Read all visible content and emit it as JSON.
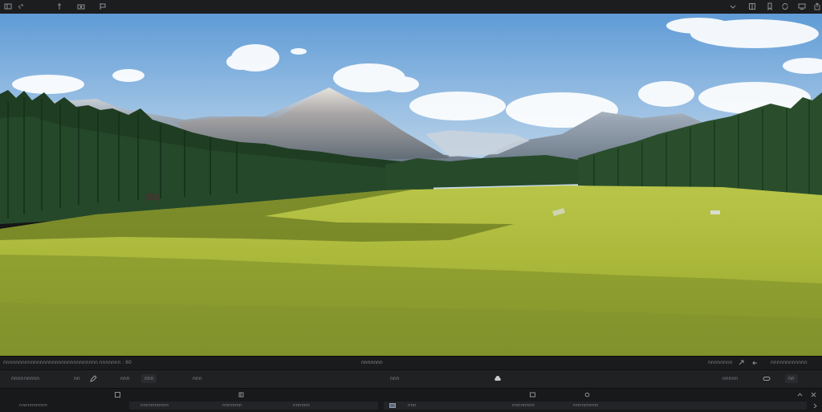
{
  "topbar": {
    "left_icons": [
      "layout-icon",
      "link-icon",
      "pin-icon",
      "camera-icon",
      "flag-icon"
    ],
    "right_icons": [
      "chevron-down-icon",
      "grid-icon",
      "bookmark-icon",
      "sync-icon",
      "monitor-icon",
      "export-icon"
    ]
  },
  "statusbar": {
    "left_text": "nnnnnnnnnnnnnnnnnnnnnnnnnnnnnnn nnnnnnn : 60",
    "center_text": "nnnnnnn",
    "right_text_1": "nnnnnnnn",
    "right_text_2": "nnnnnnnnnnnn"
  },
  "toolbar": {
    "items": [
      "nnnn",
      "nnnnn",
      "nn",
      "nnn",
      "nnn",
      "nnn",
      "nnn",
      "nnnnn",
      "nn"
    ]
  },
  "panel": {
    "left_label": "nnnnnnnnnn",
    "segment_a_texts": [
      "nnnnnnnnnn",
      "nnnnnnn",
      "nnnnnn"
    ],
    "segment_b_texts": [
      "nnn",
      "nnnnnnnn",
      "nnnnnnnnn"
    ]
  },
  "colors": {
    "chrome_dark": "#151617",
    "chrome_mid": "#202123",
    "sky_top": "#6aa1d8",
    "grass": "#a9b83a"
  }
}
